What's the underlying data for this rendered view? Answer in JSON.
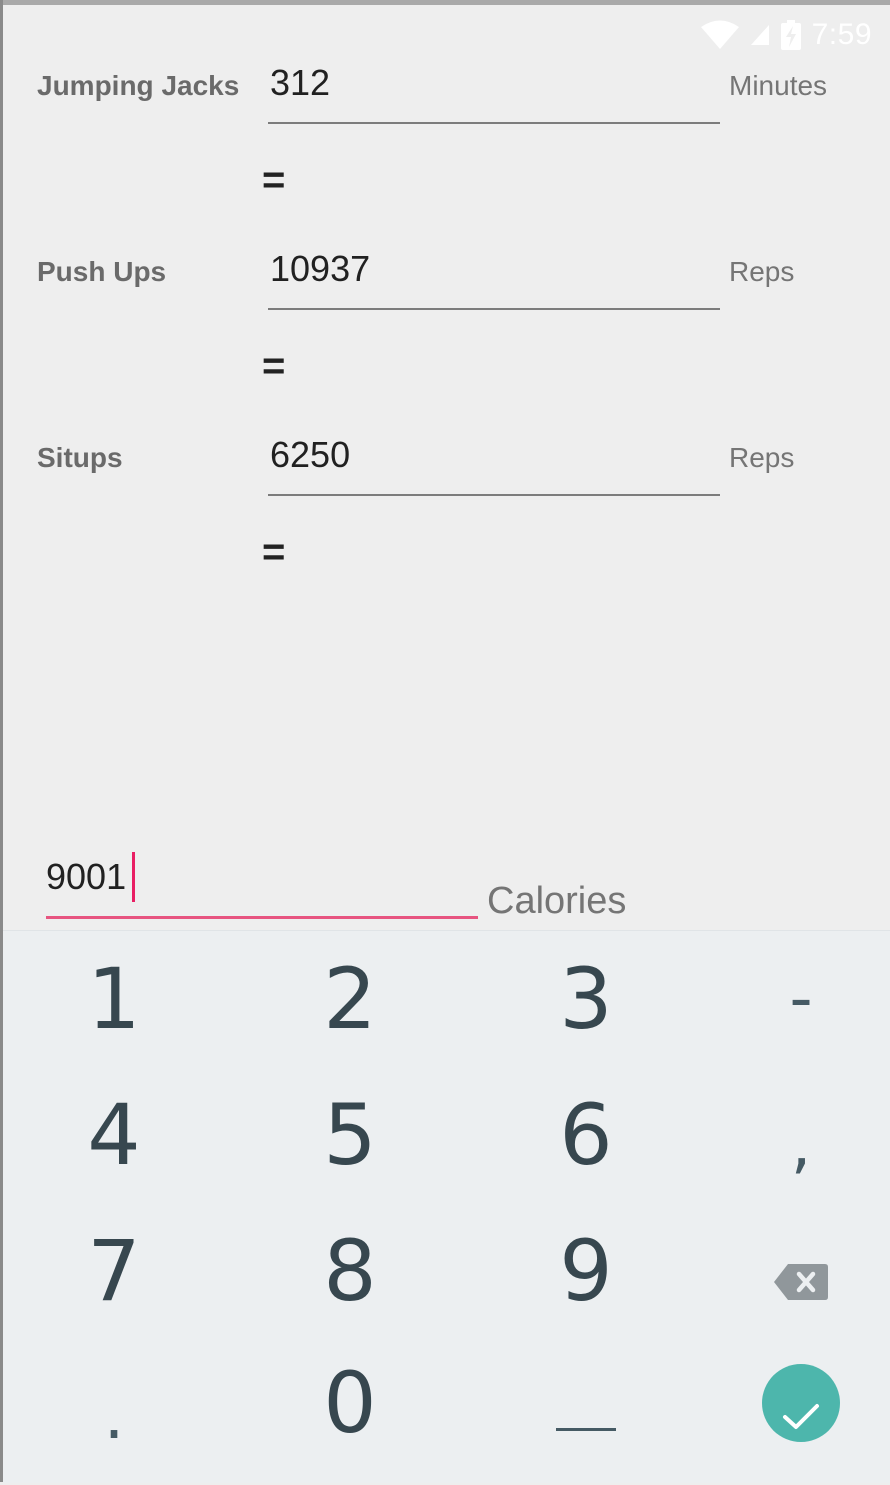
{
  "status_bar": {
    "time": "7:59"
  },
  "rows": [
    {
      "label": "Jumping Jacks",
      "value": "312",
      "unit": "Minutes"
    },
    {
      "label": "Push Ups",
      "value": "10937",
      "unit": "Reps"
    },
    {
      "label": "Situps",
      "value": "6250",
      "unit": "Reps"
    }
  ],
  "equals": "=",
  "calories": {
    "value": "9001",
    "unit": "Calories"
  },
  "keyboard": {
    "keys": [
      "1",
      "2",
      "3",
      "-",
      "4",
      "5",
      "6",
      ",",
      "7",
      "8",
      "9",
      "8",
      "0"
    ],
    "row1": [
      "1",
      "2",
      "3",
      "-"
    ],
    "row2": [
      "4",
      "5",
      "6",
      ","
    ],
    "row3": [
      "7",
      "8",
      "9"
    ],
    "row4": [
      ".",
      "0"
    ],
    "backspace_icon": "backspace-icon",
    "done_icon": "check-icon",
    "space_icon": "space-icon",
    "accent_color": "#4db6ac"
  },
  "colors": {
    "focus_underline": "#e75480",
    "background": "#eeeeee"
  }
}
